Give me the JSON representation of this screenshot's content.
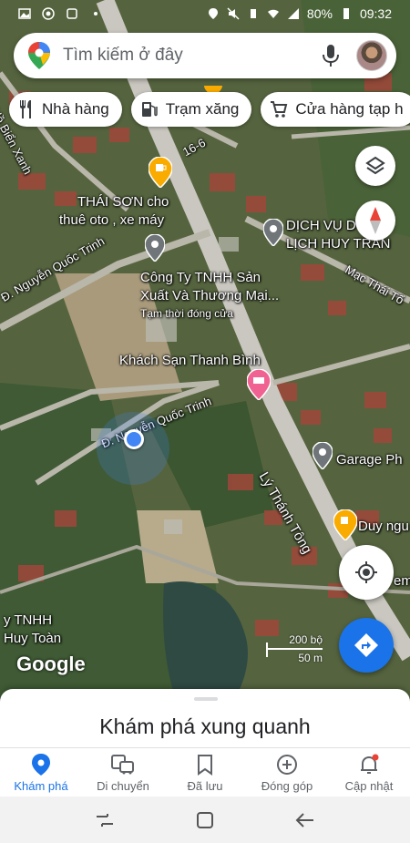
{
  "status_bar": {
    "battery": "80%",
    "time": "09:32"
  },
  "search": {
    "placeholder": "Tìm kiếm ở đây"
  },
  "chips": [
    {
      "label": "Nhà hàng",
      "icon": "restaurant-icon"
    },
    {
      "label": "Trạm xăng",
      "icon": "gas-station-icon"
    },
    {
      "label": "Cửa hàng tạp h",
      "icon": "cart-icon"
    }
  ],
  "map": {
    "labels": {
      "thai_son_1": "THÁI SƠN cho",
      "thai_son_2": "thuê oto , xe máy",
      "dich_vu_1": "DỊCH VỤ D",
      "dich_vu_2": "LỊCH HUY TRẦN",
      "cong_ty_1": "Công Ty TNHH Sản",
      "cong_ty_2": "Xuất Và Thương Mại...",
      "cong_ty_status": "Tạm thời đóng cửa",
      "khach_san": "Khách Sạn Thanh Bình",
      "garage": "Garage Ph",
      "duy_ngu": "Duy ngu",
      "huy_toan_1": "y TNHH",
      "huy_toan_2": "Huy Toàn",
      "road_16_6": "16-6",
      "road_nguyen_quoc_trinh_1": "Đ. Nguyễn Quốc Trinh",
      "road_nguyen_quoc_trinh_2": "Đ. Nguyễn Quốc Trinh",
      "road_ly_thanh_tong": "Lý Thánh Tông",
      "road_mac_thai_to": "Mạc Thái Tổ",
      "road_ho_bien": "Hồ Biển Xanh",
      "em": "em"
    },
    "scale": {
      "top": "200 bộ",
      "bottom": "50 m"
    },
    "logo": "Google"
  },
  "sheet": {
    "title": "Khám phá xung quanh"
  },
  "nav": [
    {
      "label": "Khám phá",
      "icon": "explore-pin-icon",
      "active": true
    },
    {
      "label": "Di chuyển",
      "icon": "commute-icon",
      "active": false
    },
    {
      "label": "Đã lưu",
      "icon": "bookmark-icon",
      "active": false
    },
    {
      "label": "Đóng góp",
      "icon": "add-circle-icon",
      "active": false
    },
    {
      "label": "Cập nhật",
      "icon": "bell-icon",
      "active": false
    }
  ],
  "colors": {
    "accent": "#1a73e8",
    "notification_dot": "#ea4335",
    "hotel_pin": "#f06292",
    "food_pin": "#f9ab00",
    "place_pin": "#70757a"
  }
}
